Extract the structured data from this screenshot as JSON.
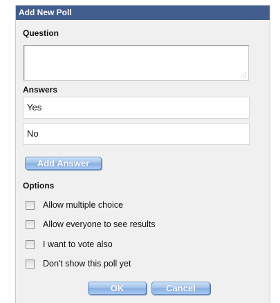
{
  "dialog": {
    "title": "Add New Poll",
    "question_label": "Question",
    "question_value": "",
    "answers_label": "Answers",
    "answers": [
      "Yes",
      "No"
    ],
    "add_answer_label": "Add Answer",
    "options_label": "Options",
    "options": [
      {
        "label": "Allow multiple choice",
        "checked": false
      },
      {
        "label": "Allow everyone to see results",
        "checked": false
      },
      {
        "label": "I want to vote also",
        "checked": false
      },
      {
        "label": "Don't show this poll yet",
        "checked": false
      }
    ],
    "ok_label": "OK",
    "cancel_label": "Cancel"
  },
  "colors": {
    "titlebar": "#425e8f",
    "panel": "#f0f0f0",
    "button_blue": "#9dbfe9"
  }
}
